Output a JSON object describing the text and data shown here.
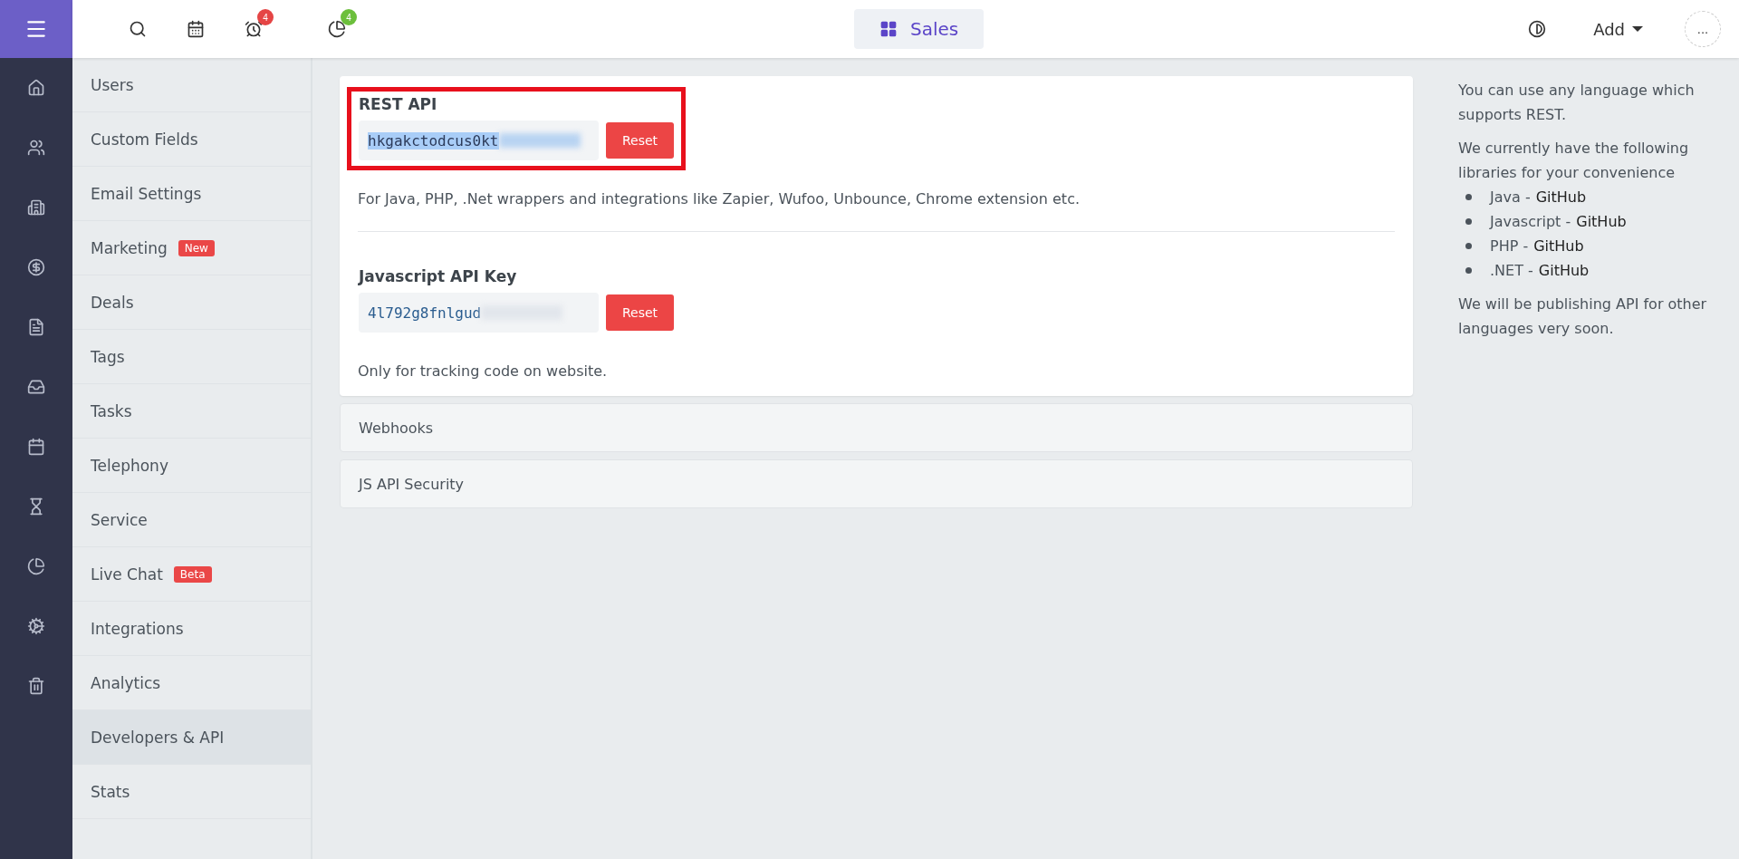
{
  "topbar": {
    "alarm_badge": "4",
    "reports_badge": "4",
    "workspace": "Sales",
    "add_label": "Add",
    "more_label": "..."
  },
  "settings_menu": [
    {
      "label": "Users",
      "selected": false
    },
    {
      "label": "Custom Fields",
      "selected": false
    },
    {
      "label": "Email Settings",
      "selected": false
    },
    {
      "label": "Marketing",
      "selected": false,
      "badge": "New"
    },
    {
      "label": "Deals",
      "selected": false
    },
    {
      "label": "Tags",
      "selected": false
    },
    {
      "label": "Tasks",
      "selected": false
    },
    {
      "label": "Telephony",
      "selected": false
    },
    {
      "label": "Service",
      "selected": false
    },
    {
      "label": "Live Chat",
      "selected": false,
      "badge": "Beta"
    },
    {
      "label": "Integrations",
      "selected": false
    },
    {
      "label": "Analytics",
      "selected": false
    },
    {
      "label": "Developers & API",
      "selected": true
    },
    {
      "label": "Stats",
      "selected": false
    }
  ],
  "api_keys": [
    {
      "title": "REST API",
      "key": "hkgakctodcus0kt",
      "text_selected": true,
      "highlighted": true,
      "button": "Reset",
      "note": "For Java, PHP, .Net wrappers and integrations like Zapier, Wufoo, Unbounce, Chrome extension etc."
    },
    {
      "title": "Javascript API Key",
      "key": "4l792g8fnlgud",
      "text_selected": false,
      "highlighted": false,
      "button": "Reset",
      "note": "Only for tracking code on website."
    }
  ],
  "sections": [
    {
      "title": "Webhooks",
      "expanded": false
    },
    {
      "title": "JS API Security",
      "expanded": false
    }
  ],
  "help": {
    "intro": "You can use any language which supports REST.",
    "libraries_intro": "We currently have the following libraries for your convenience",
    "libraries": [
      {
        "name": "Java -",
        "link": "GitHub"
      },
      {
        "name": "Javascript -",
        "link": "GitHub"
      },
      {
        "name": "PHP -",
        "link": "GitHub"
      },
      {
        "name": ".NET -",
        "link": "GitHub"
      }
    ],
    "outro": "We will be publishing API for other languages very soon."
  }
}
